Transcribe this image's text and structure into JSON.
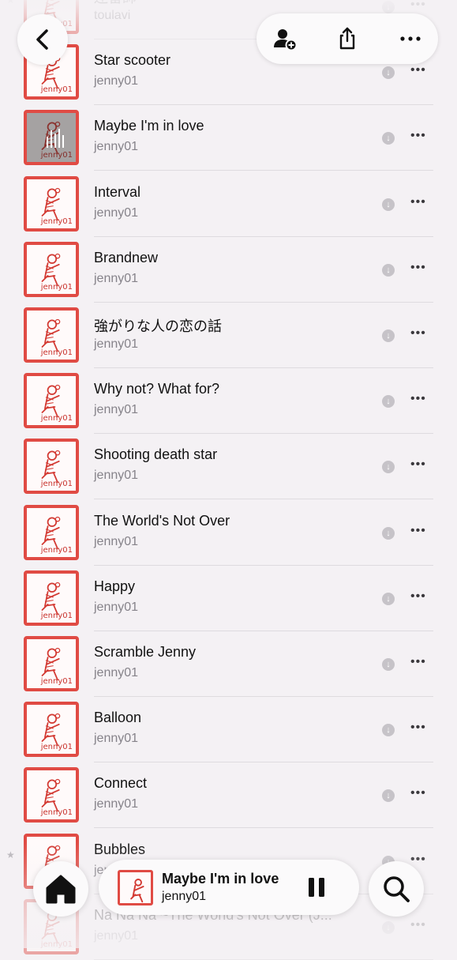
{
  "nav": {
    "back_icon": "chevron-left-icon",
    "actions": [
      {
        "name": "add-collaborator-icon"
      },
      {
        "name": "share-icon"
      },
      {
        "name": "more-icon"
      }
    ]
  },
  "tracks": [
    {
      "title": "連審師",
      "artist": "toulavi",
      "starred": true,
      "playing": false
    },
    {
      "title": "Star scooter",
      "artist": "jenny01",
      "starred": false,
      "playing": false
    },
    {
      "title": "Maybe I'm in love",
      "artist": "jenny01",
      "starred": false,
      "playing": true
    },
    {
      "title": "Interval",
      "artist": "jenny01",
      "starred": false,
      "playing": false
    },
    {
      "title": "Brandnew",
      "artist": "jenny01",
      "starred": false,
      "playing": false
    },
    {
      "title": "強がりな人の恋の話",
      "artist": "jenny01",
      "starred": false,
      "playing": false
    },
    {
      "title": "Why not? What for?",
      "artist": "jenny01",
      "starred": false,
      "playing": false
    },
    {
      "title": "Shooting death star",
      "artist": "jenny01",
      "starred": false,
      "playing": false
    },
    {
      "title": "The World's Not Over",
      "artist": "jenny01",
      "starred": false,
      "playing": false
    },
    {
      "title": "Happy",
      "artist": "jenny01",
      "starred": false,
      "playing": false
    },
    {
      "title": "Scramble Jenny",
      "artist": "jenny01",
      "starred": false,
      "playing": false
    },
    {
      "title": "Balloon",
      "artist": "jenny01",
      "starred": false,
      "playing": false
    },
    {
      "title": "Connect",
      "artist": "jenny01",
      "starred": false,
      "playing": false
    },
    {
      "title": "Bubbles",
      "artist": "jenny01",
      "starred": true,
      "playing": false
    },
    {
      "title": "Na Na Na ~The World's Not Over (J...",
      "artist": "jenny01",
      "starred": false,
      "playing": false
    }
  ],
  "artwork_label": "jenny01",
  "now_playing": {
    "title": "Maybe I'm in love",
    "artist": "jenny01",
    "state": "playing"
  },
  "tabbar": {
    "home_icon": "home-icon",
    "search_icon": "search-icon"
  },
  "colors": {
    "accent": "#e04b44",
    "background": "#f4f1f4",
    "secondary_text": "#86838a"
  }
}
